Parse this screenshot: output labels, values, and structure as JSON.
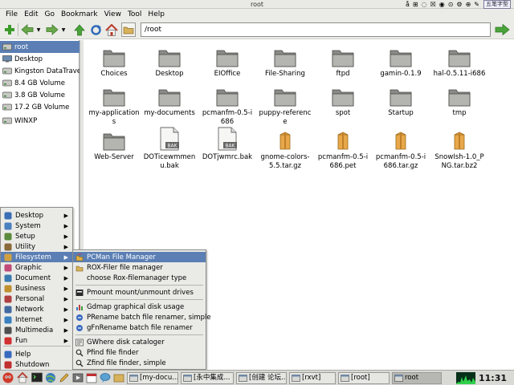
{
  "window": {
    "title": "root"
  },
  "tray": {
    "items": [
      "å",
      "⊞",
      "◌",
      "☒",
      "◉",
      "⊙",
      "⚙",
      "⊕",
      "✎"
    ],
    "ime": "五笔字型"
  },
  "menubar": {
    "items": [
      "File",
      "Edit",
      "Go",
      "Bookmark",
      "View",
      "Tool",
      "Help"
    ]
  },
  "toolbar": {
    "address": "/root",
    "icons": [
      "add-icon",
      "back-icon",
      "forward-icon",
      "up-icon",
      "refresh-icon",
      "home-icon",
      "folder-icon",
      "go-icon"
    ]
  },
  "sidebar": {
    "items": [
      {
        "label": "root",
        "icon": "drive-icon"
      },
      {
        "label": "Desktop",
        "icon": "desktop-icon"
      },
      {
        "label": "Kingston DataTraveler",
        "icon": "drive-icon"
      },
      {
        "label": "8.4 GB Volume",
        "icon": "drive-icon"
      },
      {
        "label": "3.8 GB Volume",
        "icon": "drive-icon"
      },
      {
        "label": "17.2 GB Volume",
        "icon": "drive-icon"
      },
      {
        "label": "WINXP",
        "icon": "drive-icon"
      }
    ]
  },
  "files": [
    {
      "name": "Choices",
      "type": "folder"
    },
    {
      "name": "Desktop",
      "type": "folder"
    },
    {
      "name": "EIOffice",
      "type": "folder"
    },
    {
      "name": "File-Sharing",
      "type": "folder"
    },
    {
      "name": "ftpd",
      "type": "folder"
    },
    {
      "name": "gamin-0.1.9",
      "type": "folder"
    },
    {
      "name": "hal-0.5.11-i686",
      "type": "folder"
    },
    {
      "name": "my-applications",
      "type": "folder"
    },
    {
      "name": "my-documents",
      "type": "folder"
    },
    {
      "name": "pcmanfm-0.5-i686",
      "type": "folder"
    },
    {
      "name": "puppy-reference",
      "type": "folder"
    },
    {
      "name": "spot",
      "type": "folder"
    },
    {
      "name": "Startup",
      "type": "folder"
    },
    {
      "name": "tmp",
      "type": "folder"
    },
    {
      "name": "Web-Server",
      "type": "folder"
    },
    {
      "name": "DOTicewmmenu.bak",
      "type": "bak"
    },
    {
      "name": "DOTjwmrc.bak",
      "type": "bak"
    },
    {
      "name": "gnome-colors-5.5.tar.gz",
      "type": "package"
    },
    {
      "name": "pcmanfm-0.5-i686.pet",
      "type": "package"
    },
    {
      "name": "pcmanfm-0.5-i686.tar.gz",
      "type": "package"
    },
    {
      "name": "SnowIsh-1.0_PNG.tar.bz2",
      "type": "package"
    }
  ],
  "start_menu": {
    "items": [
      {
        "label": "Desktop",
        "icon": "desktop-icon",
        "color": "#3b6fb5"
      },
      {
        "label": "System",
        "icon": "system-icon",
        "color": "#4a7fc0"
      },
      {
        "label": "Setup",
        "icon": "setup-icon",
        "color": "#5a8a3a"
      },
      {
        "label": "Utility",
        "icon": "utility-icon",
        "color": "#8a6a3a"
      },
      {
        "label": "Filesystem",
        "icon": "filesystem-icon",
        "color": "#d0a040"
      },
      {
        "label": "Graphic",
        "icon": "graphic-icon",
        "color": "#c04a7a"
      },
      {
        "label": "Document",
        "icon": "document-icon",
        "color": "#3a7ab0"
      },
      {
        "label": "Business",
        "icon": "business-icon",
        "color": "#c09030"
      },
      {
        "label": "Personal",
        "icon": "personal-icon",
        "color": "#b04040"
      },
      {
        "label": "Network",
        "icon": "network-icon",
        "color": "#406aa0"
      },
      {
        "label": "Internet",
        "icon": "internet-icon",
        "color": "#3a80c0"
      },
      {
        "label": "Multimedia",
        "icon": "multimedia-icon",
        "color": "#505050"
      },
      {
        "label": "Fun",
        "icon": "fun-icon",
        "color": "#d03030"
      },
      {
        "label": "Help",
        "icon": "help-icon",
        "color": "#3a6ac0"
      },
      {
        "label": "Shutdown",
        "icon": "shutdown-icon",
        "color": "#c03030"
      }
    ],
    "highlighted": "Filesystem"
  },
  "submenu": {
    "items": [
      {
        "label": "PCMan File Manager",
        "icon": "pcmanfm-icon"
      },
      {
        "label": "ROX-Filer file manager",
        "icon": "rox-icon"
      },
      {
        "label": "choose Rox-filemanager type",
        "icon": ""
      },
      {
        "label": "Pmount mount/unmount drives",
        "icon": "pmount-icon"
      },
      {
        "label": "Gdmap graphical disk usage",
        "icon": "gdmap-icon"
      },
      {
        "label": "PRename batch file renamer, simple",
        "icon": "rename-icon"
      },
      {
        "label": "gFnRename batch file renamer",
        "icon": "rename-icon"
      },
      {
        "label": "GWhere disk cataloger",
        "icon": "gwhere-icon"
      },
      {
        "label": "Pfind file finder",
        "icon": "search-icon"
      },
      {
        "label": "Zfind file finder, simple",
        "icon": "search-icon"
      }
    ],
    "highlighted": "PCMan File Manager"
  },
  "taskbar": {
    "tasks": [
      {
        "label": "[my-docu...",
        "active": false
      },
      {
        "label": "[永中集成...",
        "active": false
      },
      {
        "label": "[创建 论坛...",
        "active": false
      },
      {
        "label": "[rxvt]",
        "active": false
      },
      {
        "label": "[root]",
        "active": false
      },
      {
        "label": "root",
        "active": true
      }
    ],
    "clock": "11:31"
  }
}
